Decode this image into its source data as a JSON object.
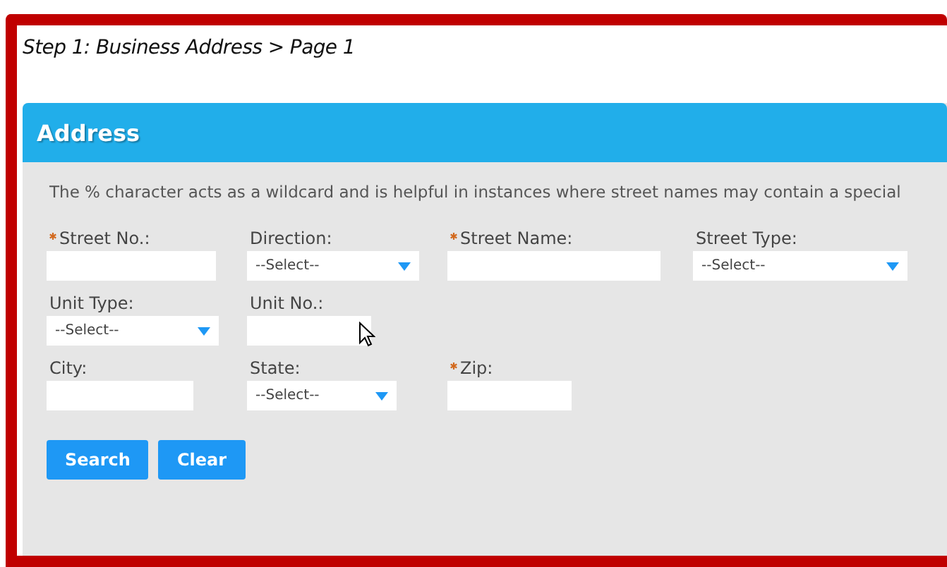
{
  "step_title": "Step 1: Business Address > Page 1",
  "panel": {
    "title": "Address",
    "hint": "The % character acts as a wildcard and is helpful in instances where street names may contain a special",
    "rows": [
      [
        {
          "label": "Street No.:",
          "required": true,
          "kind": "text"
        },
        {
          "label": "Direction:",
          "required": false,
          "kind": "select",
          "value": "--Select--"
        },
        {
          "label": "Street Name:",
          "required": true,
          "kind": "text"
        },
        {
          "label": "Street Type:",
          "required": false,
          "kind": "select",
          "value": "--Select--"
        }
      ],
      [
        {
          "label": "Unit Type:",
          "required": false,
          "kind": "select",
          "value": "--Select--"
        },
        {
          "label": "Unit No.:",
          "required": false,
          "kind": "text"
        }
      ],
      [
        {
          "label": "City:",
          "required": false,
          "kind": "text"
        },
        {
          "label": "State:",
          "required": false,
          "kind": "select",
          "value": "--Select--"
        },
        {
          "label": "Zip:",
          "required": true,
          "kind": "text"
        }
      ]
    ],
    "buttons": [
      "Search",
      "Clear"
    ]
  }
}
